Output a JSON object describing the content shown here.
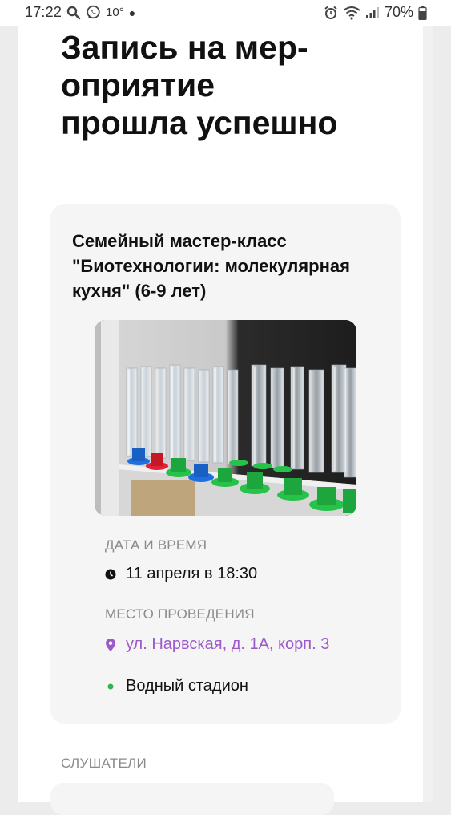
{
  "status_bar": {
    "time": "17:22",
    "temperature": "10°",
    "battery": "70%",
    "icons": [
      "search-icon",
      "whatsapp-icon",
      "alarm-icon",
      "wifi-icon",
      "signal-icon",
      "battery-icon"
    ]
  },
  "page": {
    "title_lines": [
      "Запись на мер-",
      "оприятие",
      "прошла успешно"
    ]
  },
  "event": {
    "title_lines": [
      "Семейный мастер-класс",
      "\"Биотехнологии: молекулярная",
      "кухня\" (6-9 лет)"
    ],
    "image_description": "lab-cylinders-photo",
    "datetime_label": "ДАТА И ВРЕМЯ",
    "datetime": "11 апреля в 18:30",
    "place_label": "МЕСТО ПРОВЕДЕНИЯ",
    "address": "ул. Нарвская, д. 1А, корп. 3",
    "metro": "Водный стадион"
  },
  "listeners": {
    "label": "СЛУШАТЕЛИ"
  },
  "colors": {
    "accent_purple": "#9b59c9",
    "metro_green": "#2fb54a",
    "card_bg": "#f5f5f5"
  }
}
